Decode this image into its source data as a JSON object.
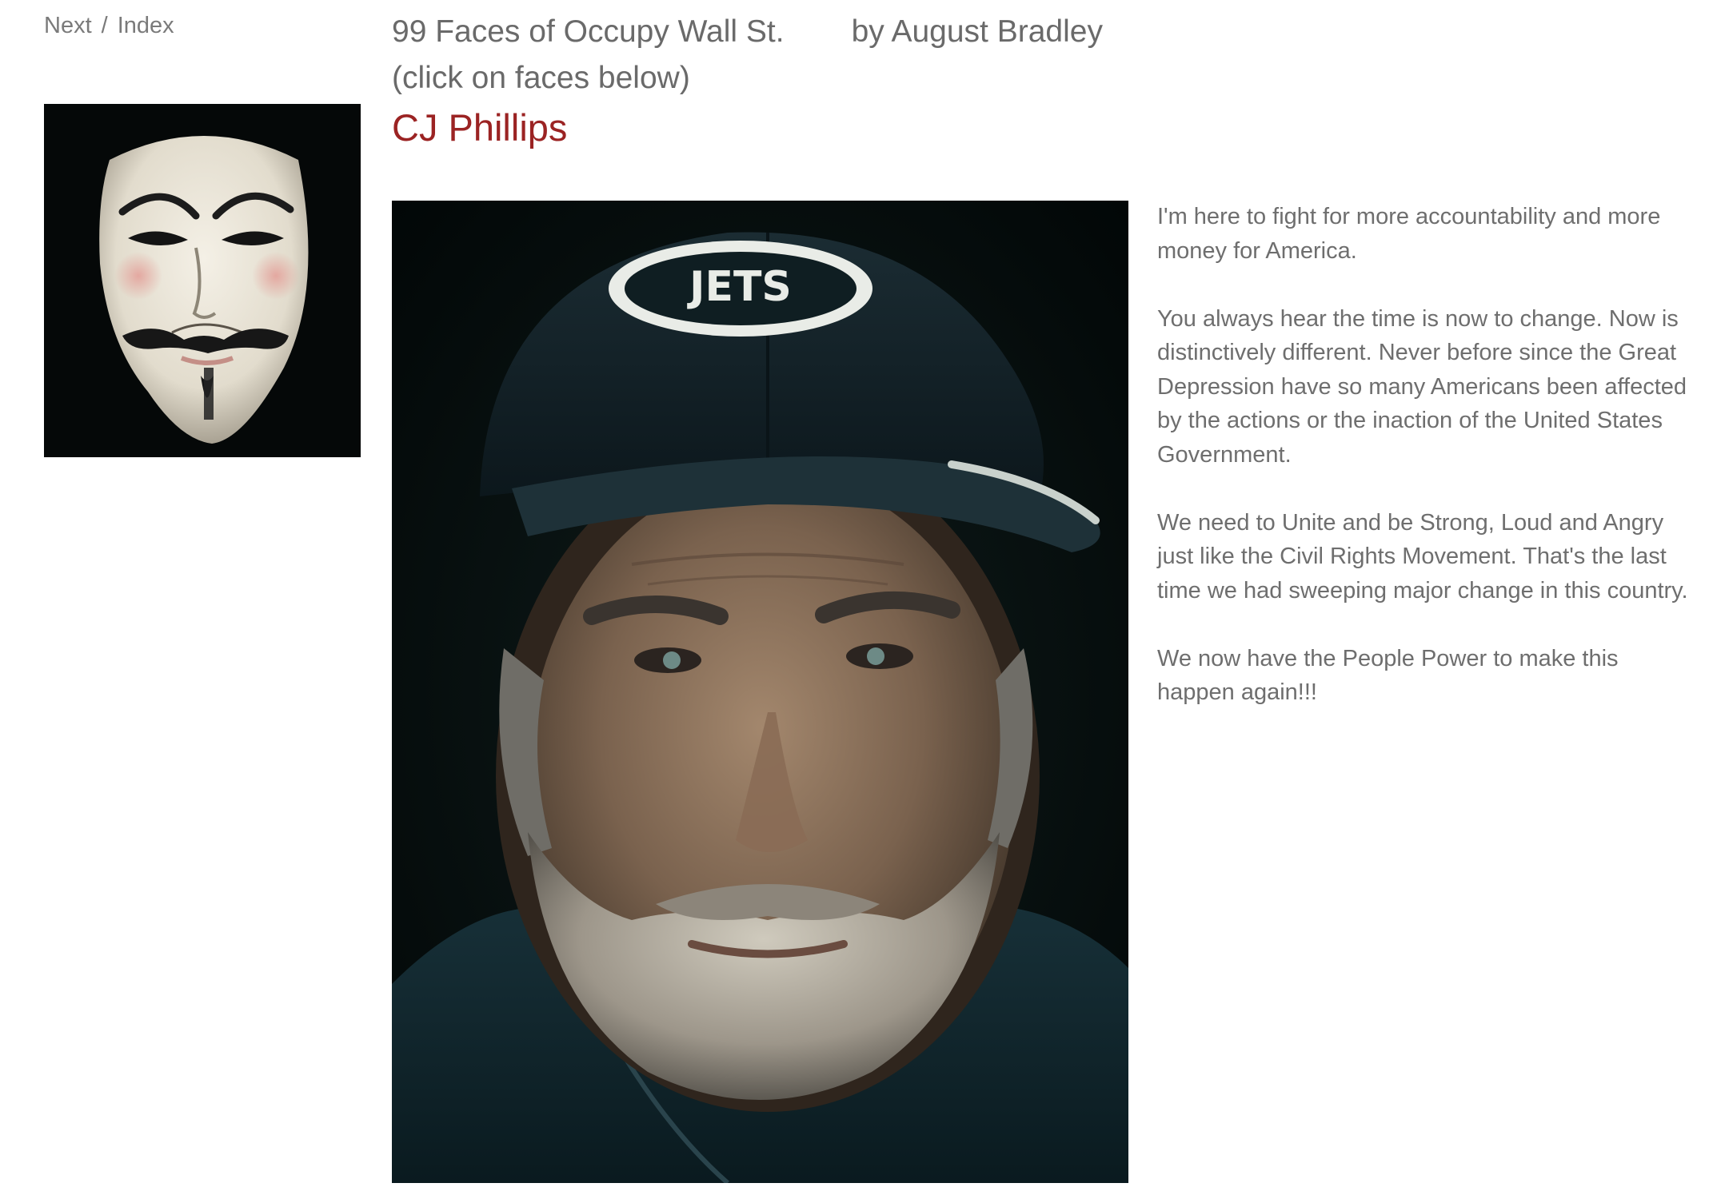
{
  "nav": {
    "next_label": "Next",
    "separator": "/",
    "index_label": "Index"
  },
  "header": {
    "series_title": "99 Faces of Occupy Wall St.",
    "author": "by August Bradley",
    "instruction": "(click on faces below)"
  },
  "person": {
    "name": "CJ Phillips",
    "name_color": "#9b2323"
  },
  "thumbnail": {
    "icon": "guy-fawkes-mask-icon"
  },
  "portrait": {
    "cap_logo_text": "JETS"
  },
  "statement": {
    "paragraphs": [
      "I'm here to fight for more accountability and more money for America.",
      "You always hear the time is now to change. Now is distinctively different. Never before since the Great Depression have so many Americans been affected by the actions or the inaction of the United States Government.",
      "We need to Unite and be Strong, Loud and Angry just like the Civil Rights Movement. That's the last time we had sweeping major change in this country.",
      "We now have the People Power to make this happen again!!!"
    ]
  }
}
